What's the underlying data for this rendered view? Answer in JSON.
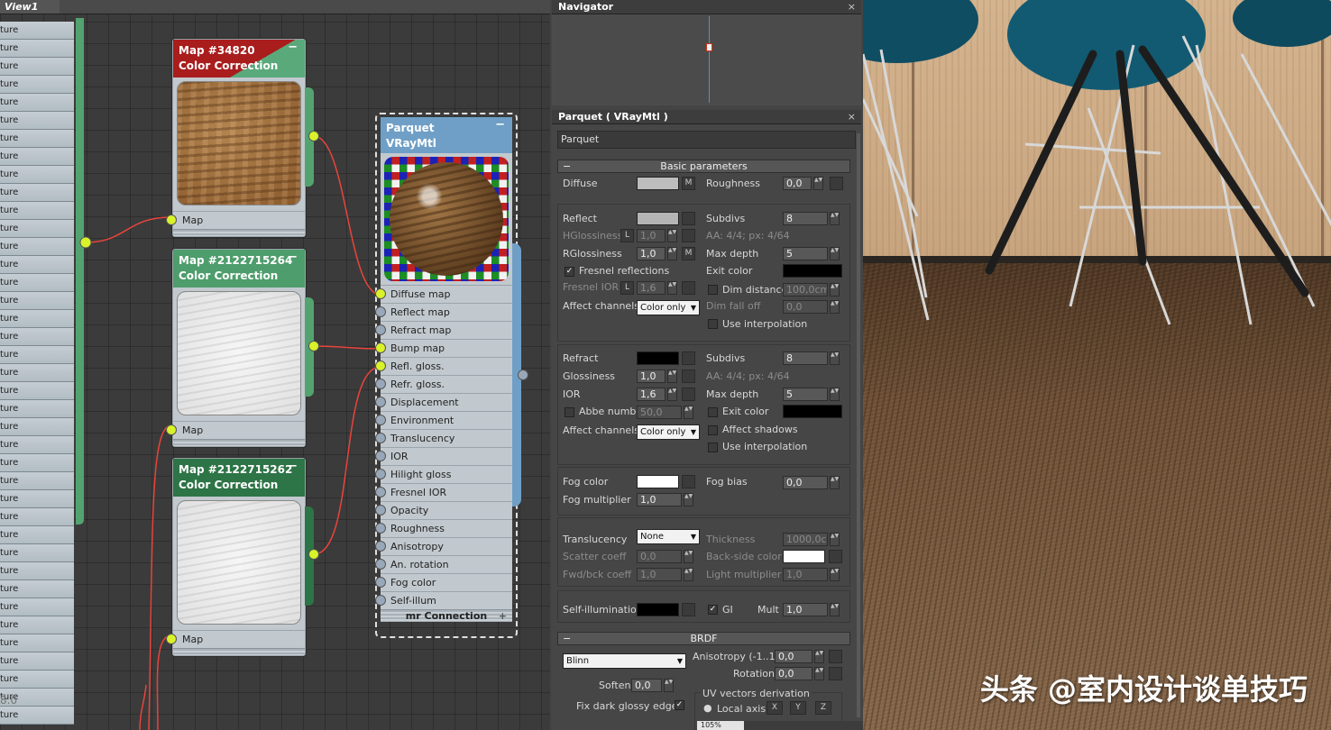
{
  "slate": {
    "view_tab": "View1",
    "left_list_items": [
      "ture",
      "ture",
      "ture",
      "ture",
      "ture",
      "ture",
      "ture",
      "ture",
      "ture",
      "ture",
      "ture",
      "ture",
      "ture",
      "ture",
      "ture",
      "ture",
      "ture",
      "ture",
      "ture",
      "ture",
      "ture",
      "ture",
      "ture",
      "ture",
      "ture",
      "ture",
      "ture",
      "ture",
      "ture",
      "ture",
      "ture",
      "ture",
      "ture",
      "ture",
      "ture",
      "ture",
      "ture",
      "ture",
      "ture"
    ],
    "left_list_overlay": "8.0",
    "nodes": [
      {
        "title": "Map #34820",
        "subtitle": "Color Correction",
        "port": "Map",
        "collapse": "−"
      },
      {
        "title": "Map #2122715264",
        "subtitle": "Color Correction",
        "port": "Map",
        "collapse": "−"
      },
      {
        "title": "Map #2122715262",
        "subtitle": "Color Correction",
        "port": "Map",
        "collapse": "−"
      }
    ],
    "material_node": {
      "title": "Parquet",
      "subtitle": "VRayMtl",
      "collapse": "−",
      "slots": [
        "Diffuse map",
        "Reflect map",
        "Refract map",
        "Bump map",
        "Refl. gloss.",
        "Refr. gloss.",
        "Displacement",
        "Environment",
        "Translucency",
        "IOR",
        "Hilight gloss",
        "Fresnel IOR",
        "Opacity",
        "Roughness",
        "Anisotropy",
        "An. rotation",
        "Fog color",
        "Self-illum"
      ],
      "connected_slots": [
        "Diffuse map",
        "Bump map",
        "Refl. gloss."
      ],
      "footer": "mr Connection",
      "footer_plus": "+"
    }
  },
  "navigator": {
    "title": "Navigator",
    "close": "×"
  },
  "params": {
    "title": "Parquet  ( VRayMtl )",
    "close": "×",
    "material_name": "Parquet",
    "rollout_basic": "Basic parameters",
    "rollout_minus": "−",
    "diffuse": {
      "label": "Diffuse",
      "m": "M",
      "roughness_label": "Roughness",
      "roughness": "0,0"
    },
    "reflect": {
      "label": "Reflect",
      "hgloss_label": "HGlossiness",
      "hgloss": "1,0",
      "l": "L",
      "rgloss_label": "RGlossiness",
      "rgloss": "1,0",
      "m": "M",
      "fresnel_label": "Fresnel reflections",
      "fresnel_ior_label": "Fresnel IOR",
      "fresnel_ior": "1,6",
      "affect_label": "Affect channels",
      "affect_value": "Color only",
      "subdivs_label": "Subdivs",
      "subdivs": "8",
      "aa": "AA: 4/4; px: 4/64",
      "maxdepth_label": "Max depth",
      "maxdepth": "5",
      "exit_label": "Exit color",
      "dimdist_label": "Dim distance",
      "dimdist": "100,0cm",
      "dimfall_label": "Dim fall off",
      "dimfall": "0,0",
      "interp_label": "Use interpolation"
    },
    "refract": {
      "label": "Refract",
      "gloss_label": "Glossiness",
      "gloss": "1,0",
      "ior_label": "IOR",
      "ior": "1,6",
      "abbe_label": "Abbe number",
      "abbe": "50,0",
      "affect_label": "Affect channels",
      "affect_value": "Color only",
      "subdivs_label": "Subdivs",
      "subdivs": "8",
      "aa": "AA: 4/4; px: 4/64",
      "maxdepth_label": "Max depth",
      "maxdepth": "5",
      "exit_label": "Exit color",
      "shadows_label": "Affect shadows",
      "interp_label": "Use interpolation"
    },
    "fog": {
      "color_label": "Fog color",
      "mult_label": "Fog multiplier",
      "mult": "1,0",
      "bias_label": "Fog bias",
      "bias": "0,0"
    },
    "translucency": {
      "label": "Translucency",
      "value": "None",
      "scatter_label": "Scatter coeff",
      "scatter": "0,0",
      "fwd_label": "Fwd/bck coeff",
      "fwd": "1,0",
      "thickness_label": "Thickness",
      "thickness": "1000,0cm",
      "backside_label": "Back-side color",
      "light_label": "Light multiplier",
      "light": "1,0"
    },
    "selfillum": {
      "label": "Self-illumination",
      "gi_label": "GI",
      "mult_label": "Mult",
      "mult": "1,0"
    },
    "brdf": {
      "rollout": "BRDF",
      "type": "Blinn",
      "aniso_label": "Anisotropy (-1..1)",
      "aniso": "0,0",
      "rotation_label": "Rotation",
      "rotation": "0,0",
      "soften_label": "Soften",
      "soften": "0,0",
      "fixdark_label": "Fix dark glossy edges",
      "uv_label": "UV vectors derivation",
      "local_label": "Local axis",
      "x": "X",
      "y": "Y",
      "z": "Z"
    }
  },
  "status": {
    "zoom": "105%"
  },
  "viewport": {
    "watermark": "头条 @室内设计谈单技巧"
  },
  "colors": {
    "node_red": "#a91d1d",
    "node_green": "#4e9d6c",
    "node_dkgreen": "#2d7446",
    "node_blue": "#6f9fc6",
    "port_connected": "#d9f229",
    "wire": "#e8443c"
  }
}
